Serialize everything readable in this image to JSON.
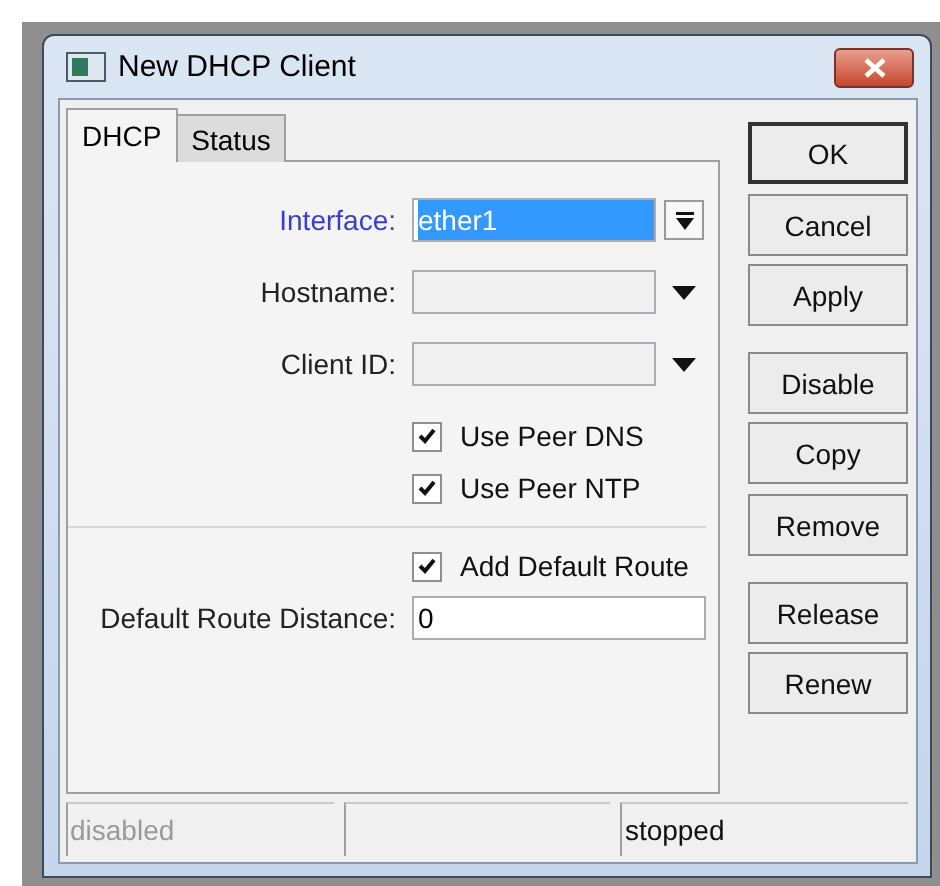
{
  "window": {
    "title": "New DHCP Client"
  },
  "tabs": [
    {
      "label": "DHCP",
      "selected": true
    },
    {
      "label": "Status",
      "selected": false
    }
  ],
  "form": [
    {
      "kind": "combo",
      "label": "Interface:",
      "value": "ether1",
      "focused": true
    },
    {
      "kind": "dropdown",
      "label": "Hostname:",
      "focused": false
    },
    {
      "kind": "dropdown",
      "label": "Client ID:",
      "focused": false
    },
    {
      "kind": "checkbox",
      "label": "Use Peer DNS",
      "checked": true
    },
    {
      "kind": "checkbox",
      "label": "Use Peer NTP",
      "checked": true
    },
    {
      "kind": "separator"
    },
    {
      "kind": "checkbox",
      "label": "Add Default Route",
      "checked": true
    },
    {
      "kind": "text",
      "label": "Default Route Distance:",
      "value": "0"
    }
  ],
  "buttons": [
    {
      "label": "OK",
      "default": true
    },
    {
      "label": "Cancel",
      "default": false
    },
    {
      "label": "Apply",
      "default": false
    },
    {
      "label": "Disable",
      "default": false
    },
    {
      "label": "Copy",
      "default": false
    },
    {
      "label": "Remove",
      "default": false
    },
    {
      "label": "Release",
      "default": false
    },
    {
      "label": "Renew",
      "default": false
    }
  ],
  "status_bar": [
    {
      "kind": "text",
      "text": "disabled",
      "disabled": true
    },
    {
      "kind": "empty"
    },
    {
      "kind": "text",
      "text": "stopped",
      "disabled": false
    }
  ]
}
